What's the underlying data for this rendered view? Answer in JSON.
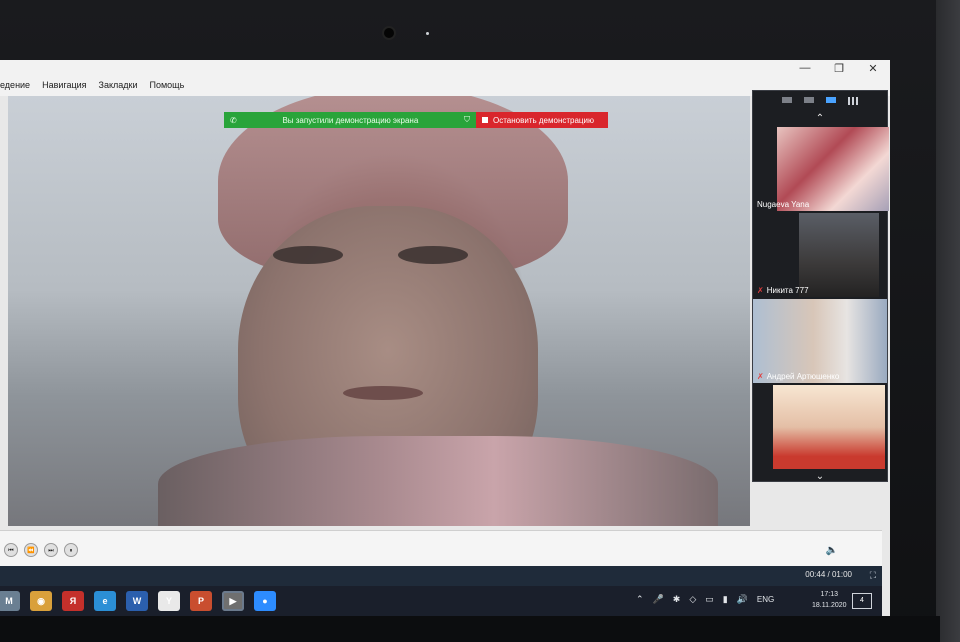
{
  "menu": {
    "items": [
      "едение",
      "Навигация",
      "Закладки",
      "Помощь"
    ]
  },
  "window_controls": {
    "minimize": "—",
    "restore": "❐",
    "close": "✕"
  },
  "share": {
    "status": "Вы запустили демонстрацию экрана",
    "stop_label": "Остановить демонстрацию"
  },
  "participants": [
    {
      "name": "Nugaeva Yana",
      "muted": false
    },
    {
      "name": "Никита 777",
      "muted": true
    },
    {
      "name": "Андрей Артюшенко",
      "muted": true
    },
    {
      "name": "",
      "muted": false
    }
  ],
  "panel_icons": {
    "up": "⌃",
    "down": "⌄"
  },
  "playback": {
    "time": "00:44 / 01:00"
  },
  "taskbar": {
    "apps": [
      {
        "icon": "gmail-icon",
        "glyph": "M",
        "color": "#6a7f92"
      },
      {
        "icon": "chrome-icon",
        "glyph": "◉",
        "color": "#d9a03b"
      },
      {
        "icon": "yandex-icon",
        "glyph": "Я",
        "color": "#c4302b"
      },
      {
        "icon": "edge-icon",
        "glyph": "e",
        "color": "#2b8fd6"
      },
      {
        "icon": "word-icon",
        "glyph": "W",
        "color": "#2b5fad"
      },
      {
        "icon": "yandex-browser-icon",
        "glyph": "Y",
        "color": "#e9e9e9"
      },
      {
        "icon": "powerpoint-icon",
        "glyph": "P",
        "color": "#c94e2f"
      },
      {
        "icon": "video-player-icon",
        "glyph": "▶",
        "color": "#6f6f6f"
      },
      {
        "icon": "zoom-icon",
        "glyph": "●",
        "color": "#2d8cff"
      }
    ],
    "lang": "ENG",
    "time": "17:13",
    "date": "18.11.2020",
    "notifications": "4"
  }
}
